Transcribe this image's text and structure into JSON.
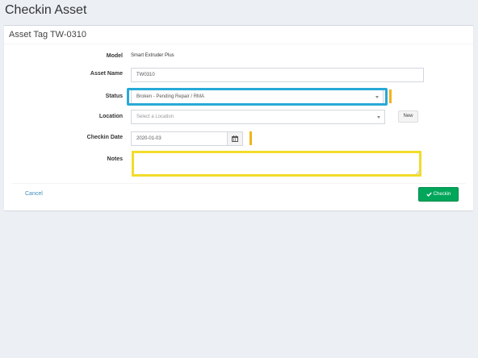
{
  "page": {
    "title": "Checkin Asset"
  },
  "box": {
    "header": "Asset Tag TW-0310"
  },
  "form": {
    "model": {
      "label": "Model",
      "value": "Smart Extruder Plus"
    },
    "asset_name": {
      "label": "Asset Name",
      "value": "TW0310"
    },
    "status": {
      "label": "Status",
      "value": "Broken - Pending Repair / RMA"
    },
    "location": {
      "label": "Location",
      "placeholder": "Select a Location",
      "new_label": "New"
    },
    "checkin_date": {
      "label": "Checkin Date",
      "value": "2020-01-03"
    },
    "notes": {
      "label": "Notes",
      "value": ""
    }
  },
  "footer": {
    "cancel_label": "Cancel",
    "checkin_label": "Checkin"
  },
  "colors": {
    "highlight_status": "#27a9d6",
    "highlight_notes": "#f2dc2a",
    "orange_marker": "#f0b41b",
    "checkin_button": "#00a65a",
    "link": "#3c8dbc"
  },
  "icons": {
    "checkin": "check-icon",
    "date": "calendar-icon",
    "dropdown": "caret-down-icon"
  }
}
